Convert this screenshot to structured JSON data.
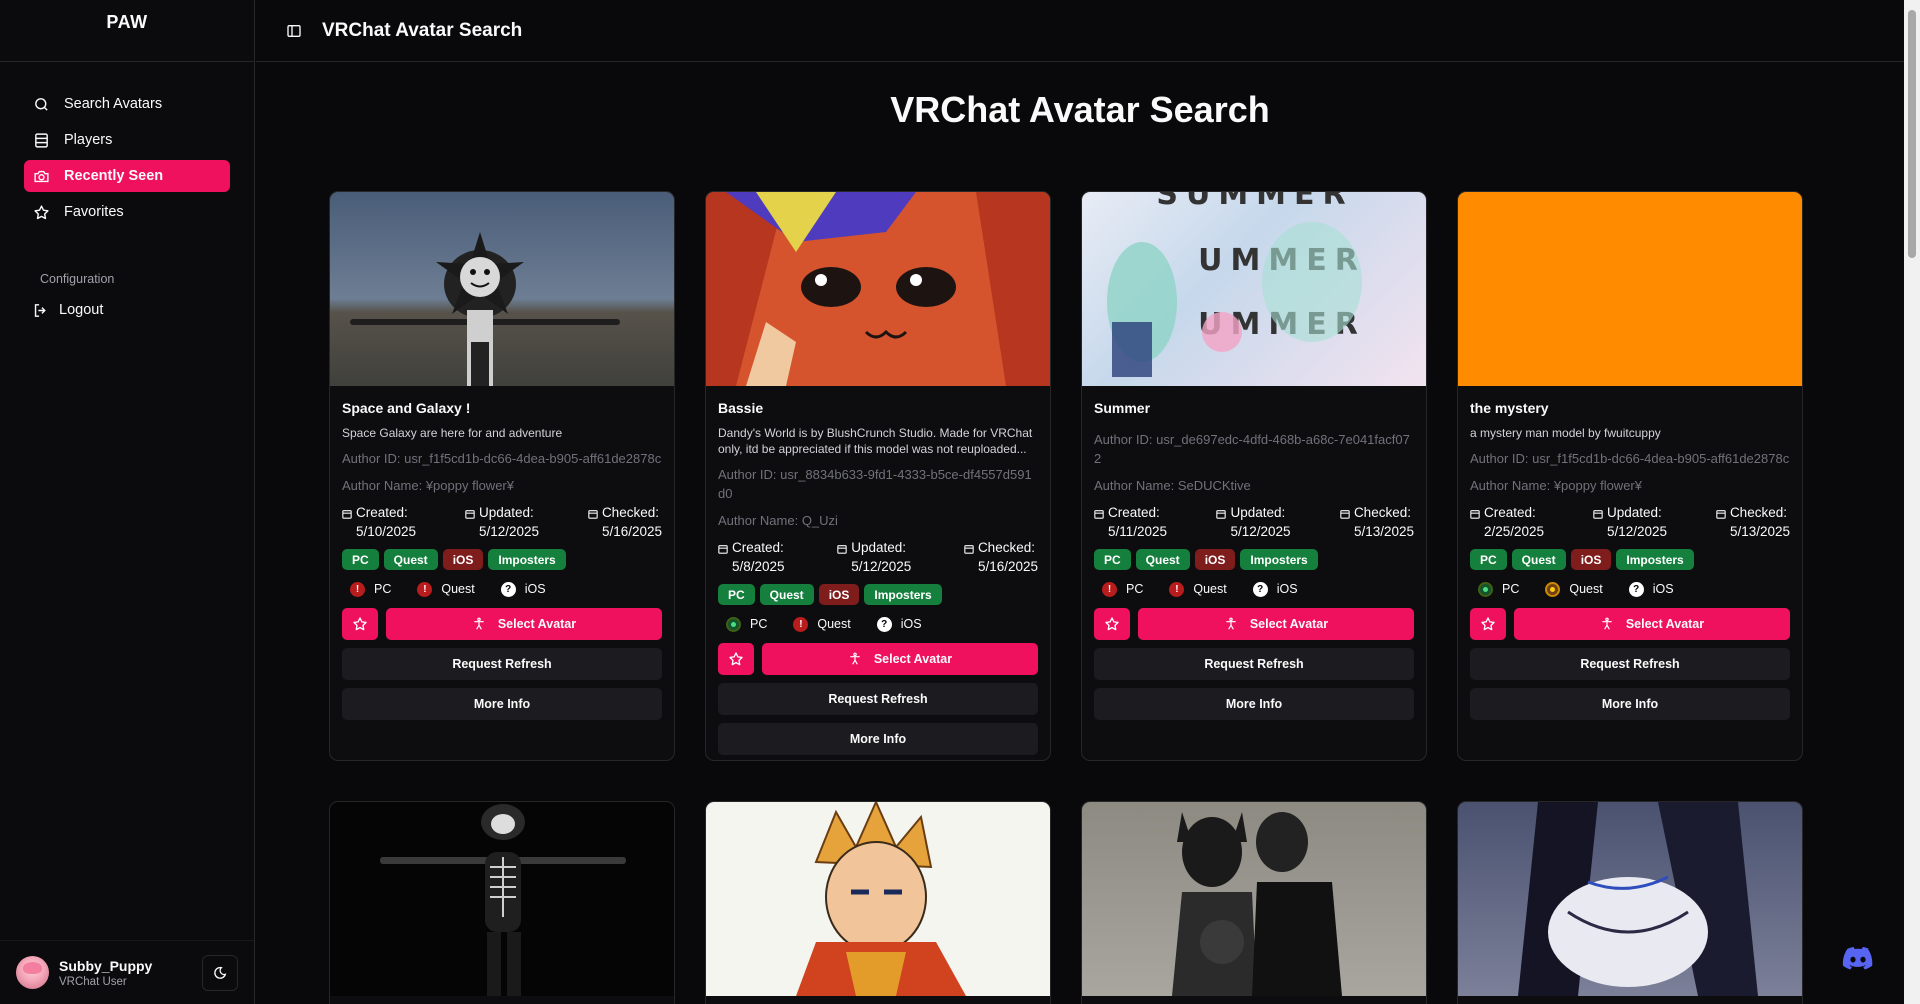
{
  "app": {
    "brand": "PAW",
    "title": "VRChat Avatar Search"
  },
  "sidebar": {
    "items": [
      {
        "label": "Search Avatars",
        "icon": "search-icon"
      },
      {
        "label": "Players",
        "icon": "table-icon"
      },
      {
        "label": "Recently Seen",
        "icon": "camera-icon",
        "active": true
      },
      {
        "label": "Favorites",
        "icon": "star-icon"
      }
    ],
    "group_label": "Configuration",
    "logout": "Logout",
    "user": {
      "name": "Subby_Puppy",
      "role": "VRChat User"
    }
  },
  "main": {
    "heading": "VRChat Avatar Search"
  },
  "labels": {
    "created": "Created:",
    "updated": "Updated:",
    "checked": "Checked:",
    "select": "Select Avatar",
    "refresh": "Request Refresh",
    "more": "More Info"
  },
  "cards": [
    {
      "title": "Space and Galaxy !",
      "desc": "Space Galaxy are here for and adventure",
      "author_id": "Author ID: usr_f1f5cd1b-dc66-4dea-b905-aff61de2878c",
      "author_name": "Author Name: ¥poppy flower¥",
      "created": "5/10/2025",
      "updated": "5/12/2025",
      "checked": "5/16/2025",
      "tags": [
        "PC",
        "Quest",
        "iOS",
        "Imposters"
      ],
      "status": [
        {
          "label": "PC",
          "state": "err"
        },
        {
          "label": "Quest",
          "state": "err"
        },
        {
          "label": "iOS",
          "state": "unknown"
        }
      ]
    },
    {
      "title": "Bassie",
      "desc": "Dandy's World is by BlushCrunch Studio. Made for VRChat only, itd be appreciated if this model was not reuploaded...",
      "author_id": "Author ID: usr_8834b633-9fd1-4333-b5ce-df4557d591d0",
      "author_name": "Author Name: Q_Uzi",
      "created": "5/8/2025",
      "updated": "5/12/2025",
      "checked": "5/16/2025",
      "tags": [
        "PC",
        "Quest",
        "iOS",
        "Imposters"
      ],
      "status": [
        {
          "label": "PC",
          "state": "ok"
        },
        {
          "label": "Quest",
          "state": "err"
        },
        {
          "label": "iOS",
          "state": "unknown"
        }
      ]
    },
    {
      "title": "Summer",
      "desc": "",
      "author_id": "Author ID: usr_de697edc-4dfd-468b-a68c-7e041facf072",
      "author_name": "Author Name: SeDUCKtive",
      "created": "5/11/2025",
      "updated": "5/12/2025",
      "checked": "5/13/2025",
      "tags": [
        "PC",
        "Quest",
        "iOS",
        "Imposters"
      ],
      "status": [
        {
          "label": "PC",
          "state": "err"
        },
        {
          "label": "Quest",
          "state": "err"
        },
        {
          "label": "iOS",
          "state": "unknown"
        }
      ]
    },
    {
      "title": "the mystery",
      "desc": "a mystery man model by fwuitcuppy",
      "author_id": "Author ID: usr_f1f5cd1b-dc66-4dea-b905-aff61de2878c",
      "author_name": "Author Name: ¥poppy flower¥",
      "created": "2/25/2025",
      "updated": "5/12/2025",
      "checked": "5/13/2025",
      "tags": [
        "PC",
        "Quest",
        "iOS",
        "Imposters"
      ],
      "status": [
        {
          "label": "PC",
          "state": "ok"
        },
        {
          "label": "Quest",
          "state": "warn"
        },
        {
          "label": "iOS",
          "state": "unknown"
        }
      ]
    }
  ],
  "colors": {
    "accent": "#f0115e",
    "tag_green": "#15803d",
    "tag_red": "#7f1d1d",
    "thumb_orange": "#ff8c00"
  }
}
